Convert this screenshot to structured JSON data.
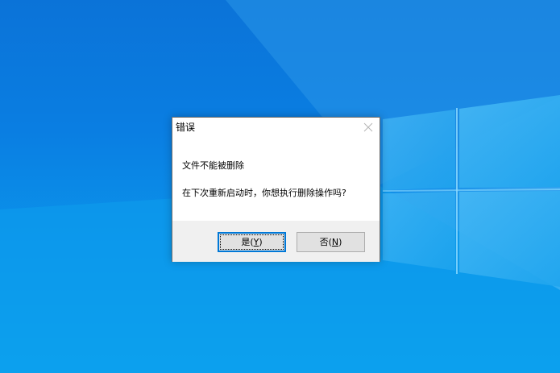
{
  "dialog": {
    "title": "错误",
    "message_line1": "文件不能被删除",
    "message_line2": "在下次重新启动时，你想执行删除操作吗?",
    "yes_button": {
      "label_prefix": "是(",
      "mnemonic": "Y",
      "label_suffix": ")"
    },
    "no_button": {
      "label_prefix": "否(",
      "mnemonic": "N",
      "label_suffix": ")"
    }
  },
  "icons": {
    "close": "close-icon"
  },
  "colors": {
    "accent": "#0078d7",
    "footer_bg": "#f0f0f0"
  }
}
